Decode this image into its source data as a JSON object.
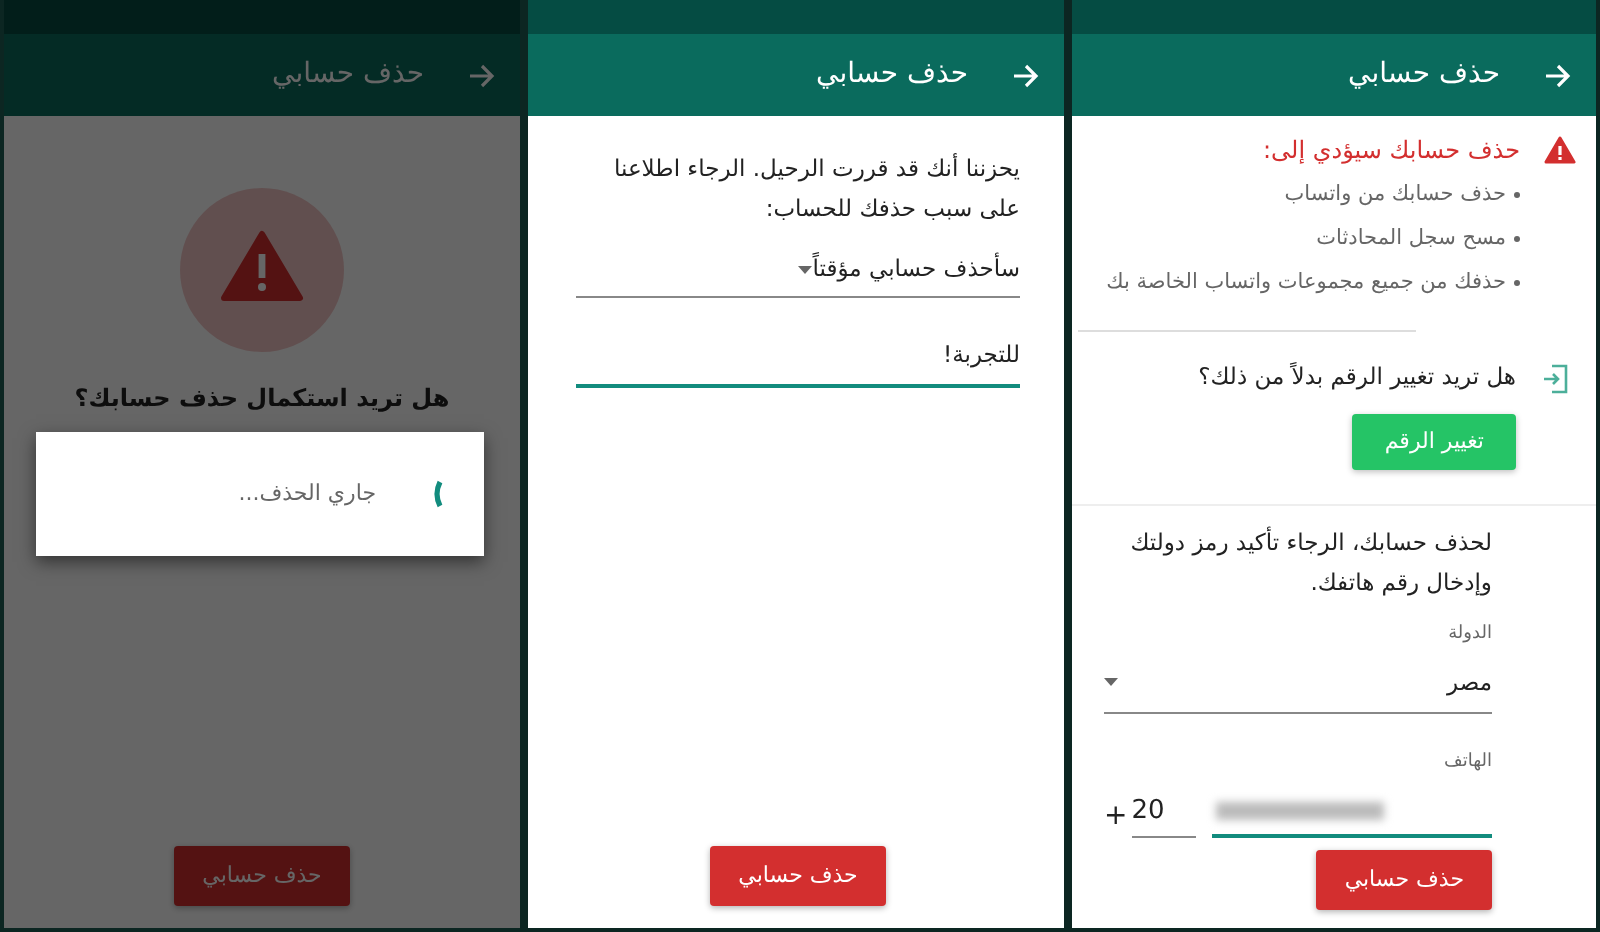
{
  "screens": [
    {
      "kind": "confirm",
      "title": "حذف حسابي",
      "warning_title": "حذف حسابك سيؤدي إلى:",
      "warning_items": [
        "حذف حسابك من واتساب",
        "مسح سجل المحادثات",
        "حذفك من جميع مجموعات واتساب الخاصة بك"
      ],
      "change_question": "هل تريد تغيير الرقم بدلاً من ذلك؟",
      "change_button": "تغيير الرقم",
      "instructions": "لحذف حسابك، الرجاء تأكيد رمز دولتك وإدخال رقم هاتفك.",
      "country_label": "الدولة",
      "country": "مصر",
      "phone_label": "الهاتف",
      "plus": "+",
      "country_code": "20",
      "button": "حذف حسابي"
    },
    {
      "kind": "reason",
      "title": "حذف حسابي",
      "prompt": "يحزننا أنك قد قررت الرحيل. الرجاء اطلاعنا على سبب حذفك للحساب:",
      "reason": "سأحذف حسابي مؤقتاً",
      "comment": "للتجربة!",
      "button": "حذف حسابي"
    },
    {
      "kind": "deleting",
      "title": "حذف حسابي",
      "question": "هل تريد استكمال حذف حسابك؟",
      "button": "حذف حسابي",
      "dialog": {
        "text": "جاري الحذف..."
      }
    }
  ]
}
